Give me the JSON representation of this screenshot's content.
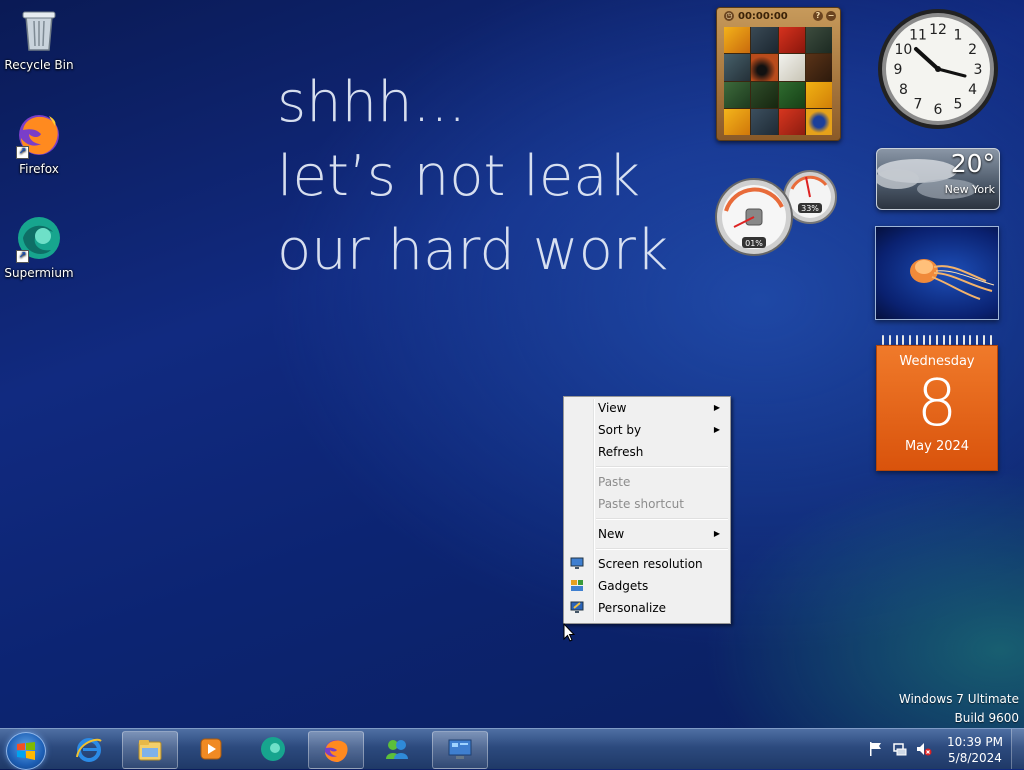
{
  "desktop": {
    "icons": [
      {
        "label": "Recycle Bin",
        "icon": "recycle-bin-icon"
      },
      {
        "label": "Firefox",
        "icon": "firefox-icon"
      },
      {
        "label": "Supermium",
        "icon": "supermium-icon"
      }
    ],
    "wallpaper_text": [
      "shhh...",
      "let’s not leak",
      "our hard work"
    ]
  },
  "gadgets": {
    "puzzle": {
      "time": "00:00:00",
      "help": "?",
      "pause": "−"
    },
    "clock": {
      "numbers": [
        "12",
        "1",
        "2",
        "3",
        "4",
        "5",
        "6",
        "7",
        "8",
        "9",
        "10",
        "11"
      ],
      "time": "10:39"
    },
    "weather": {
      "temperature": "20°",
      "city": "New York"
    },
    "cpu_meter": {
      "cpu": "01%",
      "memory": "33%"
    },
    "calendar": {
      "weekday": "Wednesday",
      "day": "8",
      "month_year": "May 2024"
    }
  },
  "context_menu": {
    "items": [
      {
        "label": "View",
        "submenu": true,
        "enabled": true
      },
      {
        "label": "Sort by",
        "submenu": true,
        "enabled": true
      },
      {
        "label": "Refresh",
        "submenu": false,
        "enabled": true
      },
      {
        "label": "Paste",
        "submenu": false,
        "enabled": false
      },
      {
        "label": "Paste shortcut",
        "submenu": false,
        "enabled": false
      },
      {
        "label": "New",
        "submenu": true,
        "enabled": true
      },
      {
        "label": "Screen resolution",
        "icon": "screen-resolution-icon",
        "enabled": true
      },
      {
        "label": "Gadgets",
        "icon": "gadgets-icon",
        "enabled": true
      },
      {
        "label": "Personalize",
        "icon": "personalize-icon",
        "enabled": true
      }
    ],
    "submenu_arrow": "▶"
  },
  "watermark": {
    "edition": "Windows 7 Ultimate",
    "build": "Build 9600"
  },
  "taskbar": {
    "pinned": [
      "internet-explorer-icon",
      "file-explorer-icon",
      "media-player-icon",
      "supermium-icon",
      "firefox-icon",
      "messenger-icon",
      "control-panel-icon"
    ],
    "clock": {
      "time": "10:39 PM",
      "date": "5/8/2024"
    }
  },
  "colors": {
    "calendar": "#e8661b",
    "taskbar": "#2c4a7e",
    "menu_bg": "#f0f0f0"
  }
}
